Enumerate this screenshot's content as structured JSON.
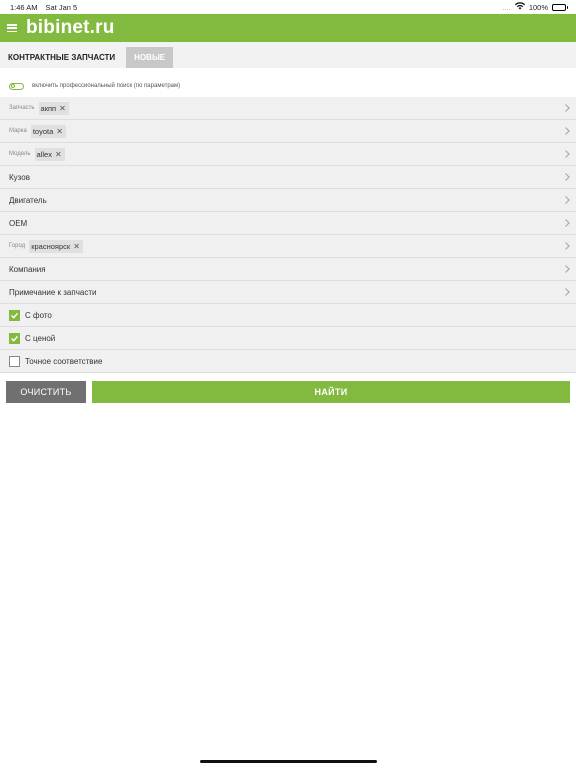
{
  "status": {
    "time": "1:46 AM",
    "date": "Sat Jan 5",
    "dots": "....",
    "battery": "100%"
  },
  "header": {
    "brand": "bibinet.ru"
  },
  "tabs": [
    {
      "label": "КОНТРАКТНЫЕ ЗАПЧАСТИ",
      "active": true
    },
    {
      "label": "НОВЫЕ",
      "active": false
    }
  ],
  "toggle": {
    "label": "включить профессиональный поиск (по параметрам)"
  },
  "filters": {
    "part": {
      "label": "Запчасть",
      "value": "акпп"
    },
    "brand": {
      "label": "Марка",
      "value": "toyota"
    },
    "model": {
      "label": "Модель",
      "value": "allex"
    },
    "body": {
      "label": "Кузов"
    },
    "engine": {
      "label": "Двигатель"
    },
    "oem": {
      "label": "OEM"
    },
    "city": {
      "label": "Город",
      "value": "красноярск"
    },
    "company": {
      "label": "Компания"
    },
    "note": {
      "label": "Примечание к запчасти"
    }
  },
  "checkboxes": {
    "photo": {
      "label": "С фото",
      "checked": true
    },
    "price": {
      "label": "С ценой",
      "checked": true
    },
    "exact": {
      "label": "Точное соответствие",
      "checked": false
    }
  },
  "buttons": {
    "clear": "ОЧИСТИТЬ",
    "find": "НАЙТИ"
  },
  "colors": {
    "accent": "#82b93f",
    "clear_button": "#707070",
    "row_bg": "#f0f0f0"
  }
}
